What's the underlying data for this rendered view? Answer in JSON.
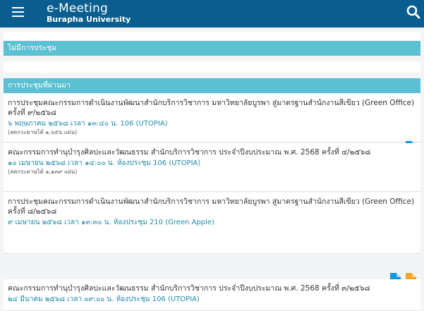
{
  "header": {
    "title": "e-Meeting",
    "subtitle": "Burapha University"
  },
  "sections": {
    "no_meeting": "ไม่มีการประชุม",
    "past_meetings": "การประชุมที่ผ่านมา"
  },
  "meetings": [
    {
      "title": "การประชุมคณะกรรมการดำเนินงานพัฒนาสำนักบริการวิชาการ มหาวิทยาลัยบูรพา สู่มาตรฐานสำนักงานสีเขียว (Green Office) ครั้งที่ ๙/๒๕๖๘",
      "meta": "๖ พฤษภาคม ๒๕๖๘ เวลา ๑๓:๔๐ น. 106 (UTOPIA)",
      "note": "(ลดกระดาษได้ ๑,๖๕๖ แผ่น)",
      "actions": [
        "document-icon"
      ]
    },
    {
      "title": "คณะกรรมการทำนุบำรุงศิลปะและวัฒนธรรม สำนักบริการวิชาการ ประจำปีงบประมาณ พ.ศ. 2568 ครั้งที่ ๔/๒๕๖๘",
      "meta": "๑๐ เมษายน ๒๕๖๘ เวลา ๑๔:๐๐ น. ห้องประชุม 106 (UTOPIA)",
      "note": "(ลดกระดาษได้ ๑,๑๓๙ แผ่น)",
      "actions": [
        "video-icon",
        "document-icon"
      ]
    },
    {
      "title": "การประชุมคณะกรรมการดำเนินงานพัฒนาสำนักบริการวิชาการ มหาวิทยาลัยบูรพา สู่มาตรฐานสำนักงานสีเขียว (Green Office) ครั้งที่ ๘/๒๕๖๘",
      "meta": "๙ เมษายน ๒๕๖๘ เวลา ๑๓:๓๐ น. ห้องประชุม 210 (Green Apple)",
      "note": "",
      "actions": [
        "document-icon",
        "document-orange-icon"
      ]
    },
    {
      "title": "คณะกรรมการทำนุบำรุงศิลปะและวัฒนธรรม สำนักบริการวิชาการ ประจำปีงบประมาณ พ.ศ. 2568 ครั้งที่ ๓/๒๕๖๘",
      "meta": "๒๔ มีนาคม ๒๕๖๘ เวลา ๐๙:๐๐ น. ห้องประชุม 106 (UTOPIA)",
      "note": "",
      "actions": []
    }
  ],
  "colors": {
    "appbar": "#0a5d8f",
    "section": "#5bc0d2",
    "icon_blue": "#1496dc",
    "icon_orange": "#f5a623"
  }
}
